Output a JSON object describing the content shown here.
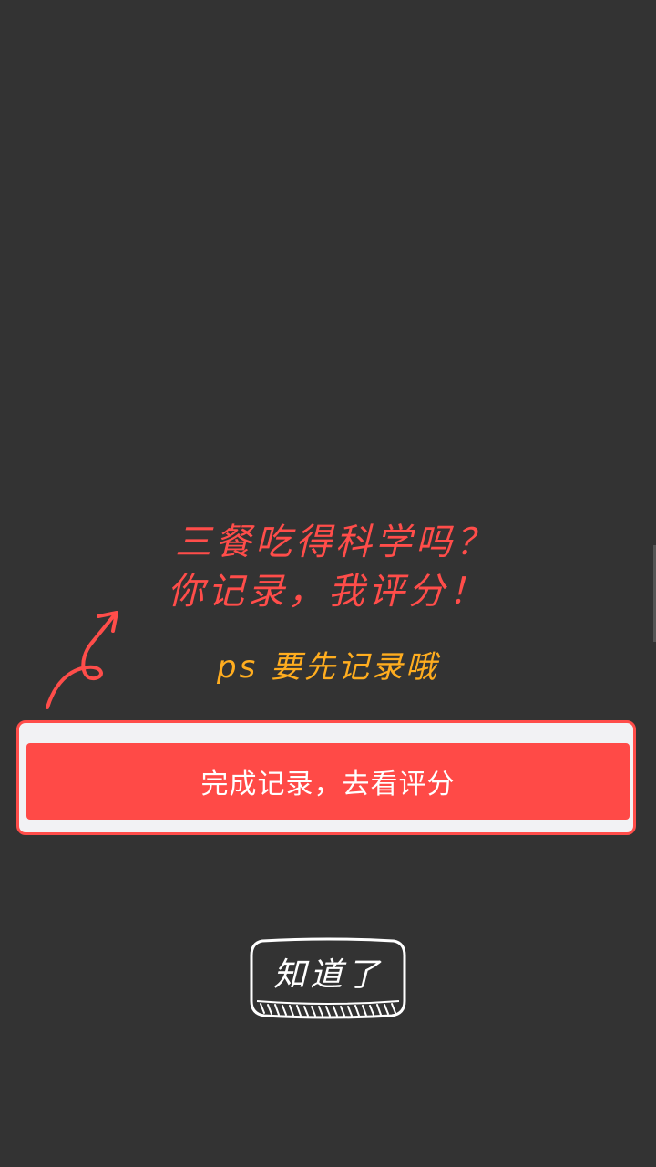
{
  "guide": {
    "headline_line1": "三餐吃得科学吗？",
    "headline_line2": "你记录，我评分！",
    "ps_note": "ps 要先记录哦",
    "primary_button_label": "完成记录，去看评分",
    "dismiss_label": "知道了"
  },
  "colors": {
    "background": "#333333",
    "accent_red": "#ff4d4a",
    "note_orange": "#ffad1f",
    "frame_fill": "#f2f2f4",
    "button_text": "#ffffff"
  },
  "icons": {
    "pointer": "curly-arrow-icon",
    "dismiss_frame": "sketch-button-frame"
  }
}
